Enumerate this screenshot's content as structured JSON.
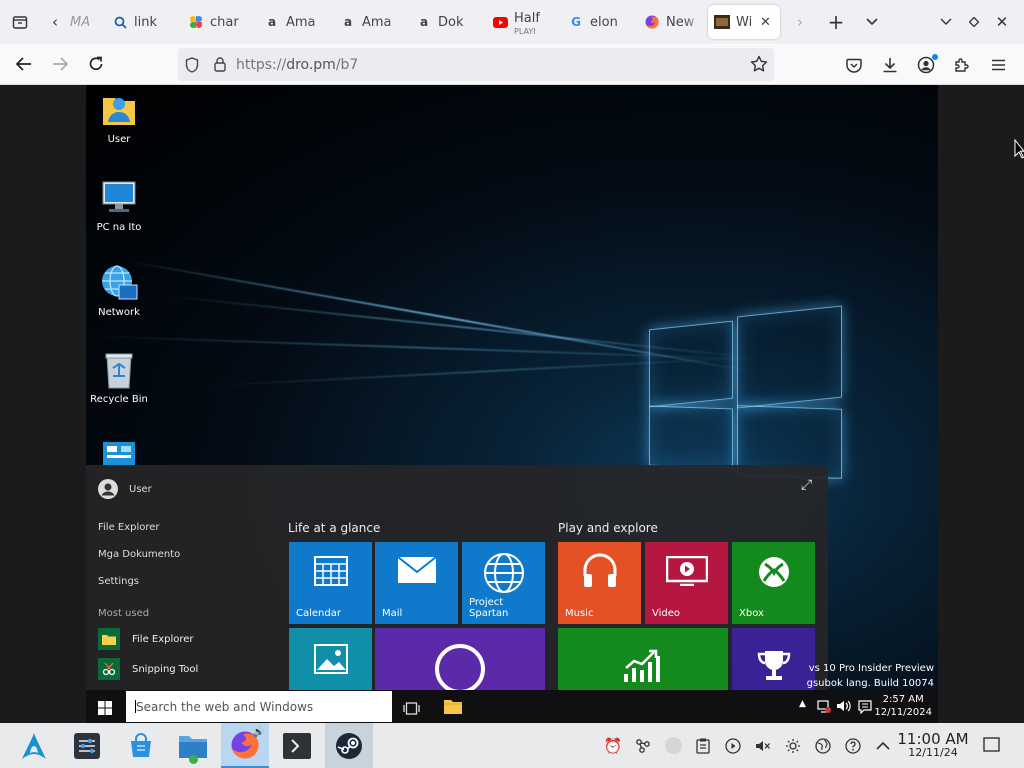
{
  "browser": {
    "tabs": [
      {
        "title": "MA",
        "favicon": "generic"
      },
      {
        "title": "link",
        "favicon": "search-icon"
      },
      {
        "title": "char",
        "favicon": "pinwheel-icon"
      },
      {
        "title": "Ama",
        "favicon": "amazon-icon"
      },
      {
        "title": "Ama",
        "favicon": "amazon-icon"
      },
      {
        "title": "Dok",
        "favicon": "amazon-icon"
      },
      {
        "title": "Half",
        "subtitle": "PLAYI",
        "favicon": "youtube-icon"
      },
      {
        "title": "elon",
        "favicon": "google-icon"
      },
      {
        "title": "New",
        "favicon": "firefox-icon"
      },
      {
        "title": "Wi",
        "favicon": "site-icon",
        "active": true
      }
    ],
    "url": {
      "scheme": "https://",
      "host": "dro.pm",
      "path": "/b7"
    }
  },
  "desktop": {
    "icons": [
      {
        "label": "User"
      },
      {
        "label": "PC na Ito"
      },
      {
        "label": "Network"
      },
      {
        "label": "Recycle Bin"
      }
    ]
  },
  "start_menu": {
    "user": "User",
    "links": [
      "File Explorer",
      "Mga Dokumento",
      "Settings"
    ],
    "most_used_label": "Most used",
    "most_used": [
      "File Explorer",
      "Snipping Tool"
    ],
    "groups": [
      "Life at a glance",
      "Play and explore"
    ],
    "tiles": [
      {
        "label": "Calendar",
        "color": "#0f7acb"
      },
      {
        "label": "Mail",
        "color": "#0f7acb"
      },
      {
        "label": "Project Spartan",
        "color": "#0f7acb"
      },
      {
        "label": "Music",
        "color": "#e45127"
      },
      {
        "label": "Video",
        "color": "#b51740"
      },
      {
        "label": "Xbox",
        "color": "#148a1e"
      }
    ]
  },
  "guest_taskbar": {
    "search_placeholder": "Search the web and Windows",
    "time": "2:57 AM",
    "date": "12/11/2024"
  },
  "watermark": {
    "line1": "vs 10 Pro Insider Preview",
    "line2": "gsubok lang. Build 10074"
  },
  "host_panel": {
    "time": "11:00 AM",
    "date": "12/11/24"
  }
}
